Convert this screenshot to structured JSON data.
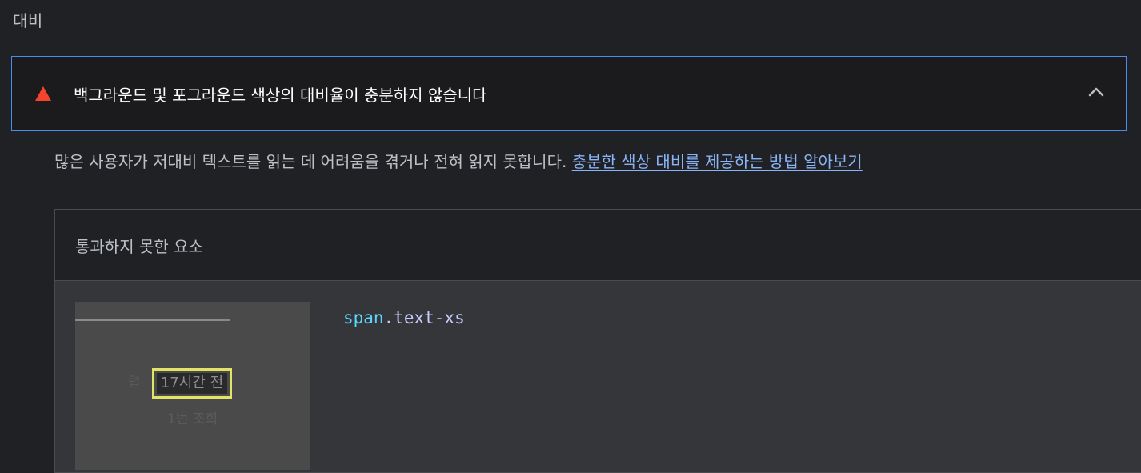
{
  "section": {
    "title": "대비"
  },
  "audit": {
    "title": "백그라운드 및 포그라운드 색상의 대비율이 충분하지 않습니다",
    "status_icon": "fail-triangle-icon",
    "status_color": "#f4442e",
    "accent_border": "#4a8bf0",
    "expand_icon": "chevron-up-icon"
  },
  "description": {
    "text": "많은 사용자가 저대비 텍스트를 읽는 데 어려움을 겪거나 전혀 읽지 못합니다. ",
    "link_text": "충분한 색상 대비를 제공하는 방법 알아보기",
    "link_color": "#8ab4f8"
  },
  "failing_elements": {
    "header": "통과하지 못한 요소",
    "items": [
      {
        "selector_tag": "span",
        "selector_class": ".text-xs",
        "thumbnail": {
          "highlight_text": "17시간 전",
          "faded_left_text": "렵",
          "subtext": "1번 조회"
        }
      }
    ]
  }
}
